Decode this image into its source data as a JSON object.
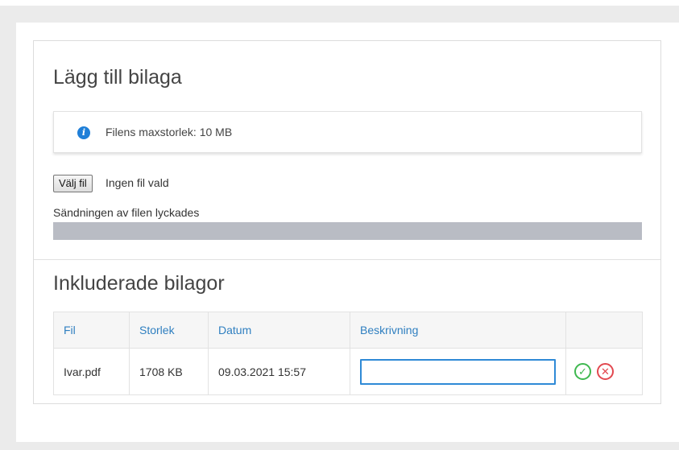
{
  "attachment": {
    "title": "Lägg till bilaga",
    "info_text": "Filens maxstorlek: 10 MB",
    "file_button_label": "Välj fil",
    "file_status": "Ingen fil vald",
    "upload_message": "Sändningen av filen lyckades",
    "upload_progress_percent": 100
  },
  "included": {
    "title": "Inkluderade bilagor",
    "columns": [
      "Fil",
      "Storlek",
      "Datum",
      "Beskrivning",
      ""
    ],
    "rows": [
      {
        "file": "Ivar.pdf",
        "size": "1708 KB",
        "date": "09.03.2021 15:57",
        "description": ""
      }
    ]
  },
  "icons": {
    "info": "info-icon",
    "confirm": "check-circle-icon",
    "cancel": "close-circle-icon"
  },
  "colors": {
    "accent": "#2f7fc0",
    "info": "#1f7fd8",
    "confirm": "#3eb84f",
    "cancel": "#e2484f",
    "progress": "#b9bcc4"
  }
}
